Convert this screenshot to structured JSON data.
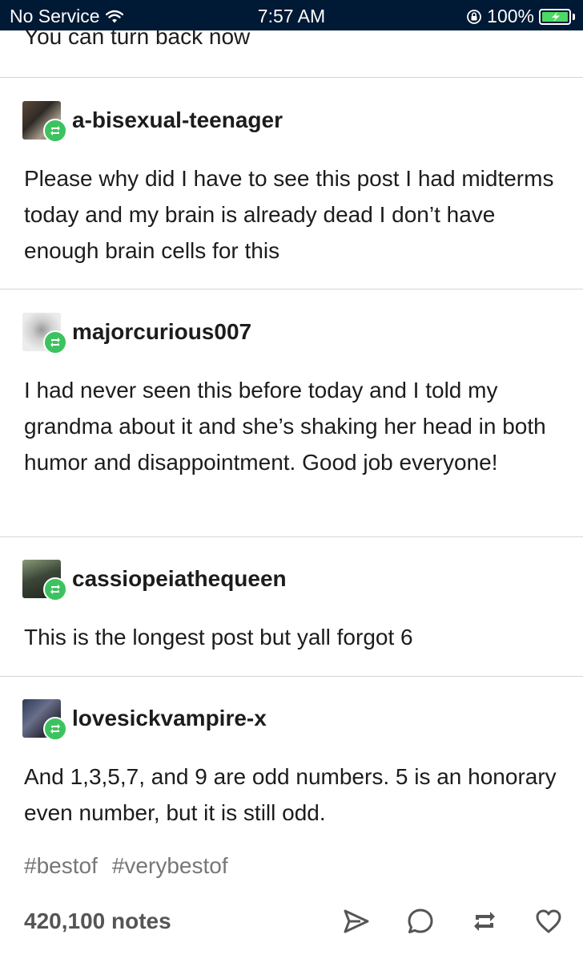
{
  "status_bar": {
    "carrier": "No Service",
    "time": "7:57 AM",
    "battery_percent": "100%",
    "battery_level": 1.0,
    "battery_color": "#4cd964"
  },
  "top_text": "You can turn back now",
  "reblogs": [
    {
      "username": "a-bisexual-teenager",
      "text": "Please why did I have to see this post I had midterms today and my brain is already dead I don’t have enough brain cells for this"
    },
    {
      "username": "majorcurious007",
      "text": "I had never seen this before today and I told my grandma about it and she’s shaking her head in both humor and disappointment. Good job everyone!"
    },
    {
      "username": "cassiopeiathequeen",
      "text": "This is the longest post but yall forgot 6"
    },
    {
      "username": "lovesickvampire-x",
      "text": "And 1,3,5,7, and 9 are odd numbers. 5 is an honorary even number, but it is still odd."
    }
  ],
  "tags": [
    "#bestof",
    "#verybestof"
  ],
  "footer": {
    "notes": "420,100 notes",
    "icons": [
      "share-icon",
      "reply-icon",
      "reblog-icon",
      "like-icon"
    ]
  },
  "colors": {
    "status_bar_bg": "#001935",
    "reblog_badge": "#3cc35f",
    "tag_text": "#777777"
  }
}
